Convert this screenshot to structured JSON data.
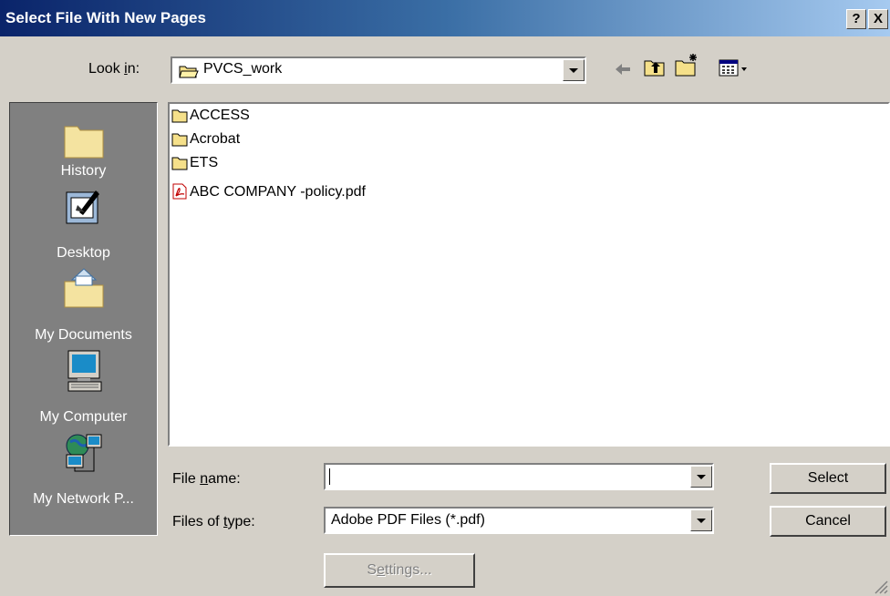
{
  "window": {
    "title": "Select File With New Pages",
    "help_label": "?",
    "close_label": "X"
  },
  "look_in": {
    "label_pre": "Look ",
    "label_u": "i",
    "label_post": "n:",
    "value": "PVCS_work"
  },
  "places": [
    {
      "label": "History",
      "icon": "history-folder-icon"
    },
    {
      "label": "Desktop",
      "icon": "desktop-icon"
    },
    {
      "label": "My Documents",
      "icon": "my-documents-icon"
    },
    {
      "label": "My Computer",
      "icon": "my-computer-icon"
    },
    {
      "label": "My Network P...",
      "icon": "network-places-icon"
    }
  ],
  "files": [
    {
      "name": "ACCESS",
      "type": "folder"
    },
    {
      "name": "Acrobat",
      "type": "folder"
    },
    {
      "name": "ETS",
      "type": "folder"
    },
    {
      "name": "ABC COMPANY -policy.pdf",
      "type": "pdf"
    }
  ],
  "file_name": {
    "label_pre": "File ",
    "label_u": "n",
    "label_post": "ame:",
    "value": ""
  },
  "file_type": {
    "label_pre": "Files of ",
    "label_u": "t",
    "label_post": "ype:",
    "value": "Adobe PDF Files (*.pdf)"
  },
  "buttons": {
    "select": "Select",
    "cancel": "Cancel",
    "settings_pre": "S",
    "settings_u": "e",
    "settings_post": "ttings..."
  }
}
